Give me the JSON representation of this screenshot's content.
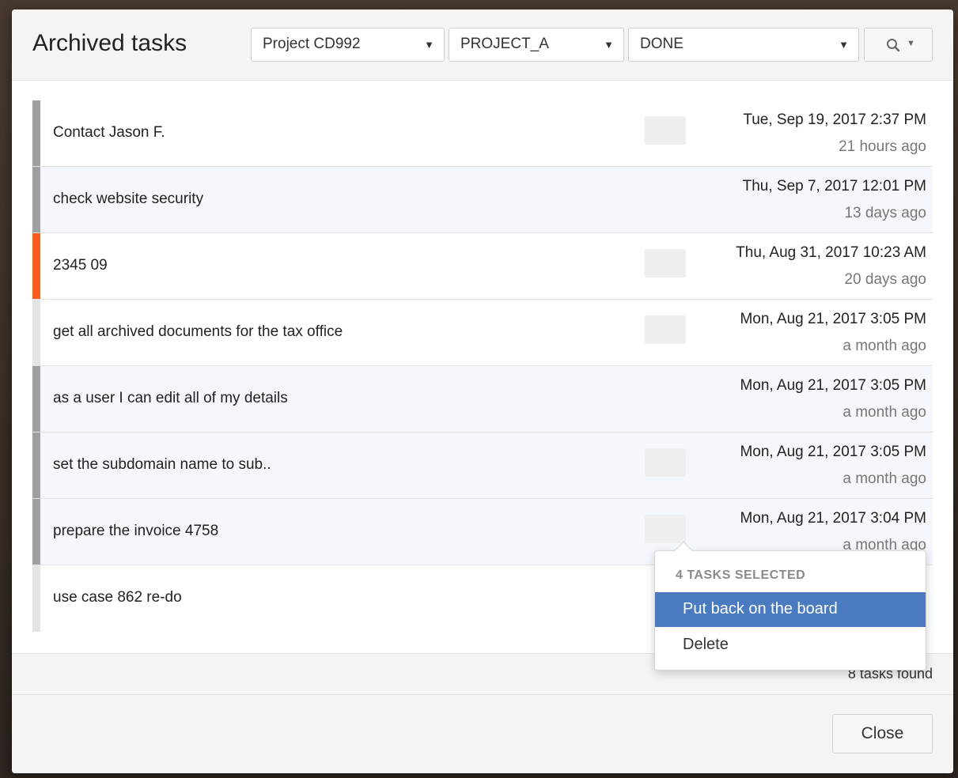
{
  "modal": {
    "title": "Archived tasks",
    "filters": {
      "project": "Project CD992",
      "board": "PROJECT_A",
      "status": "DONE"
    },
    "search_icon": "search-icon",
    "tasks": [
      {
        "title": "Contact Jason F.",
        "date": "Tue, Sep 19, 2017 2:37 PM",
        "ago": "21 hours ago"
      },
      {
        "title": "check website security",
        "date": "Thu, Sep 7, 2017 12:01 PM",
        "ago": "13 days ago"
      },
      {
        "title": "2345 09",
        "date": "Thu, Aug 31, 2017 10:23 AM",
        "ago": "20 days ago"
      },
      {
        "title": "get all archived documents for the tax office",
        "date": "Mon, Aug 21, 2017 3:05 PM",
        "ago": "a month ago"
      },
      {
        "title": "as a user I can edit all of my details",
        "date": "Mon, Aug 21, 2017 3:05 PM",
        "ago": "a month ago"
      },
      {
        "title": "set the subdomain name to sub..",
        "date": "Mon, Aug 21, 2017 3:05 PM",
        "ago": "a month ago"
      },
      {
        "title": "prepare the invoice 4758",
        "date": "Mon, Aug 21, 2017 3:04 PM",
        "ago": "a month ago"
      },
      {
        "title": "use case 862 re-do",
        "date": "",
        "ago": ""
      }
    ],
    "tasks_found": "8 tasks found",
    "close_label": "Close"
  },
  "context_menu": {
    "header": "4 TASKS SELECTED",
    "items": [
      "Put back on the board",
      "Delete"
    ]
  },
  "colors": {
    "accent": "#4a7bc0",
    "priority_high": "#ff5c1c",
    "priority_default": "#a0a0a0"
  }
}
